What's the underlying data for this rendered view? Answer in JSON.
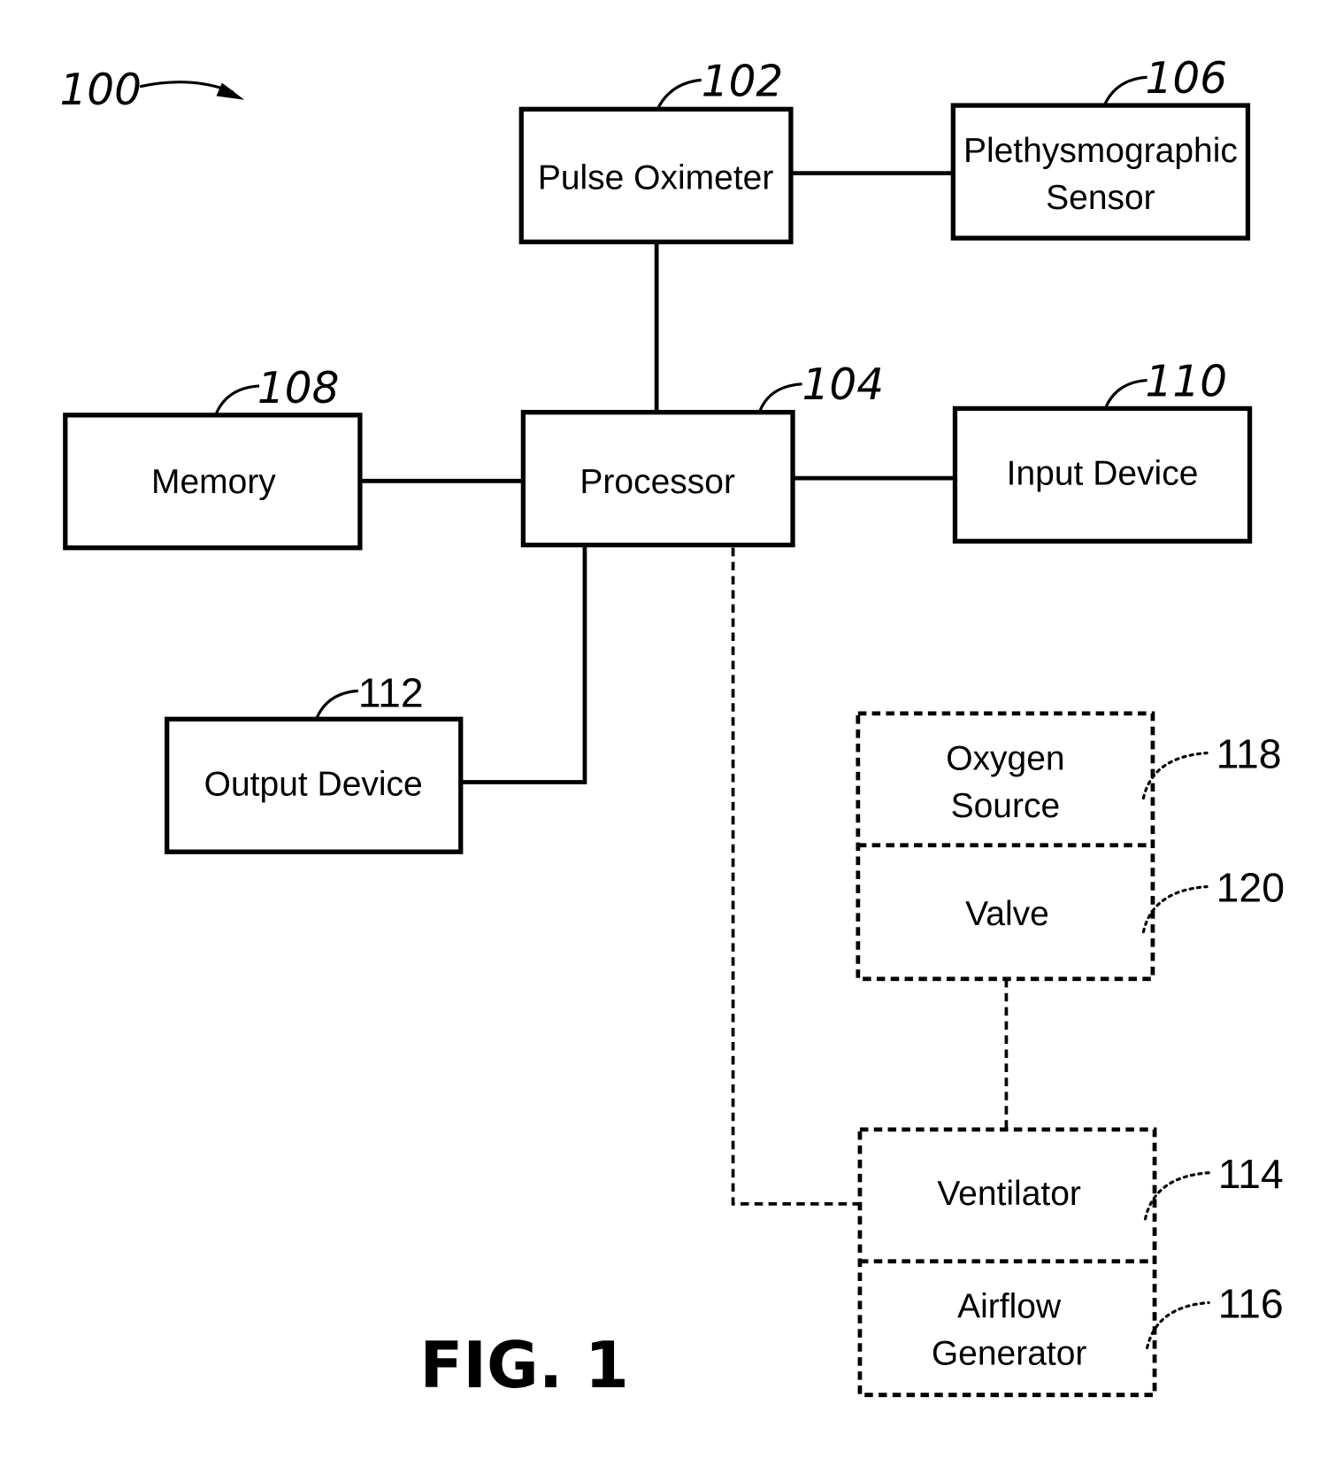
{
  "figure": {
    "system_ref": "100",
    "caption": "FIG. 1"
  },
  "components": [
    {
      "id": "pulse-oximeter",
      "ref": "102",
      "lines": [
        "Pulse Oximeter"
      ],
      "style": "solid"
    },
    {
      "id": "processor",
      "ref": "104",
      "lines": [
        "Processor"
      ],
      "style": "solid"
    },
    {
      "id": "plethysmographic-sensor",
      "ref": "106",
      "lines": [
        "Plethysmographic",
        "Sensor"
      ],
      "style": "solid"
    },
    {
      "id": "memory",
      "ref": "108",
      "lines": [
        "Memory"
      ],
      "style": "solid"
    },
    {
      "id": "input-device",
      "ref": "110",
      "lines": [
        "Input Device"
      ],
      "style": "solid"
    },
    {
      "id": "output-device",
      "ref": "112",
      "lines": [
        "Output Device"
      ],
      "style": "solid"
    },
    {
      "id": "ventilator",
      "ref": "114",
      "lines": [
        "Ventilator"
      ],
      "style": "dashed"
    },
    {
      "id": "airflow-generator",
      "ref": "116",
      "lines": [
        "Airflow",
        "Generator"
      ],
      "style": "dashed"
    },
    {
      "id": "oxygen-source",
      "ref": "118",
      "lines": [
        "Oxygen",
        "Source"
      ],
      "style": "dashed"
    },
    {
      "id": "valve",
      "ref": "120",
      "lines": [
        "Valve"
      ],
      "style": "dashed"
    }
  ],
  "connections": [
    {
      "from": "pulse-oximeter",
      "to": "plethysmographic-sensor",
      "style": "solid"
    },
    {
      "from": "pulse-oximeter",
      "to": "processor",
      "style": "solid"
    },
    {
      "from": "memory",
      "to": "processor",
      "style": "solid"
    },
    {
      "from": "processor",
      "to": "input-device",
      "style": "solid"
    },
    {
      "from": "processor",
      "to": "output-device",
      "style": "solid"
    },
    {
      "from": "processor",
      "to": "ventilator",
      "style": "dashed"
    },
    {
      "from": "valve",
      "to": "ventilator",
      "style": "dashed"
    }
  ]
}
